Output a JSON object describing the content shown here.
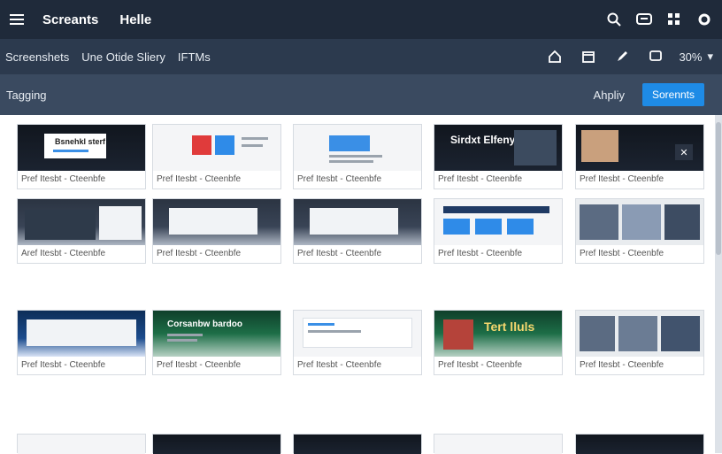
{
  "app": {
    "title": "Screants",
    "subtitle": "Helle"
  },
  "topbar": {
    "icons": [
      "search-icon",
      "chat-icon",
      "grid-icon",
      "gear-icon"
    ]
  },
  "navbar": {
    "items": [
      "Screenshets",
      "Une Otide Sliery",
      "IFTMs"
    ],
    "right_icons": [
      "home-icon",
      "calendar-icon",
      "edit-icon",
      "comment-icon"
    ],
    "zoom_value": "30%"
  },
  "tagbar": {
    "label": "Tagging",
    "apply_label": "Ahpliy",
    "primary_label": "Sorennts"
  },
  "grid": {
    "captions": [
      "Pref Itesbt - Cteenbfe",
      "Pref Itesbt - Cteenbfe",
      "Pref Itesbt - Cteenbfe",
      "Pref Itesbt - Cteenbfe",
      "Pref Itesbt - Cteenbfe",
      "Aref Itesbt - Cteenbfe",
      "Pref Itesbt - Cteenbfe",
      "Pref Itesbt - Cteenbfe",
      "Pref Itesbt - Cteenbfe",
      "Pref Itesbt - Cteenbfe",
      "Pref Itesbt - Cteenbfe",
      "Pref Itesbt - Cteenbfe",
      "Pref Itesbt - Cteenbfe",
      "Pref Itesbt - Cteenbfe",
      "Pref Itesbt - Cteenbfe"
    ],
    "thumbnail_texts": {
      "card0": "Bsnehkl sterf",
      "card3": "Sirdxt Elfeny",
      "card8": "Corsanbw bardoo",
      "card13": "Tert lluls"
    }
  },
  "colors": {
    "topbar": "#1f2a3a",
    "navbar": "#2c3a4e",
    "tagbar": "#3a4a60",
    "primary": "#1e8be6"
  }
}
